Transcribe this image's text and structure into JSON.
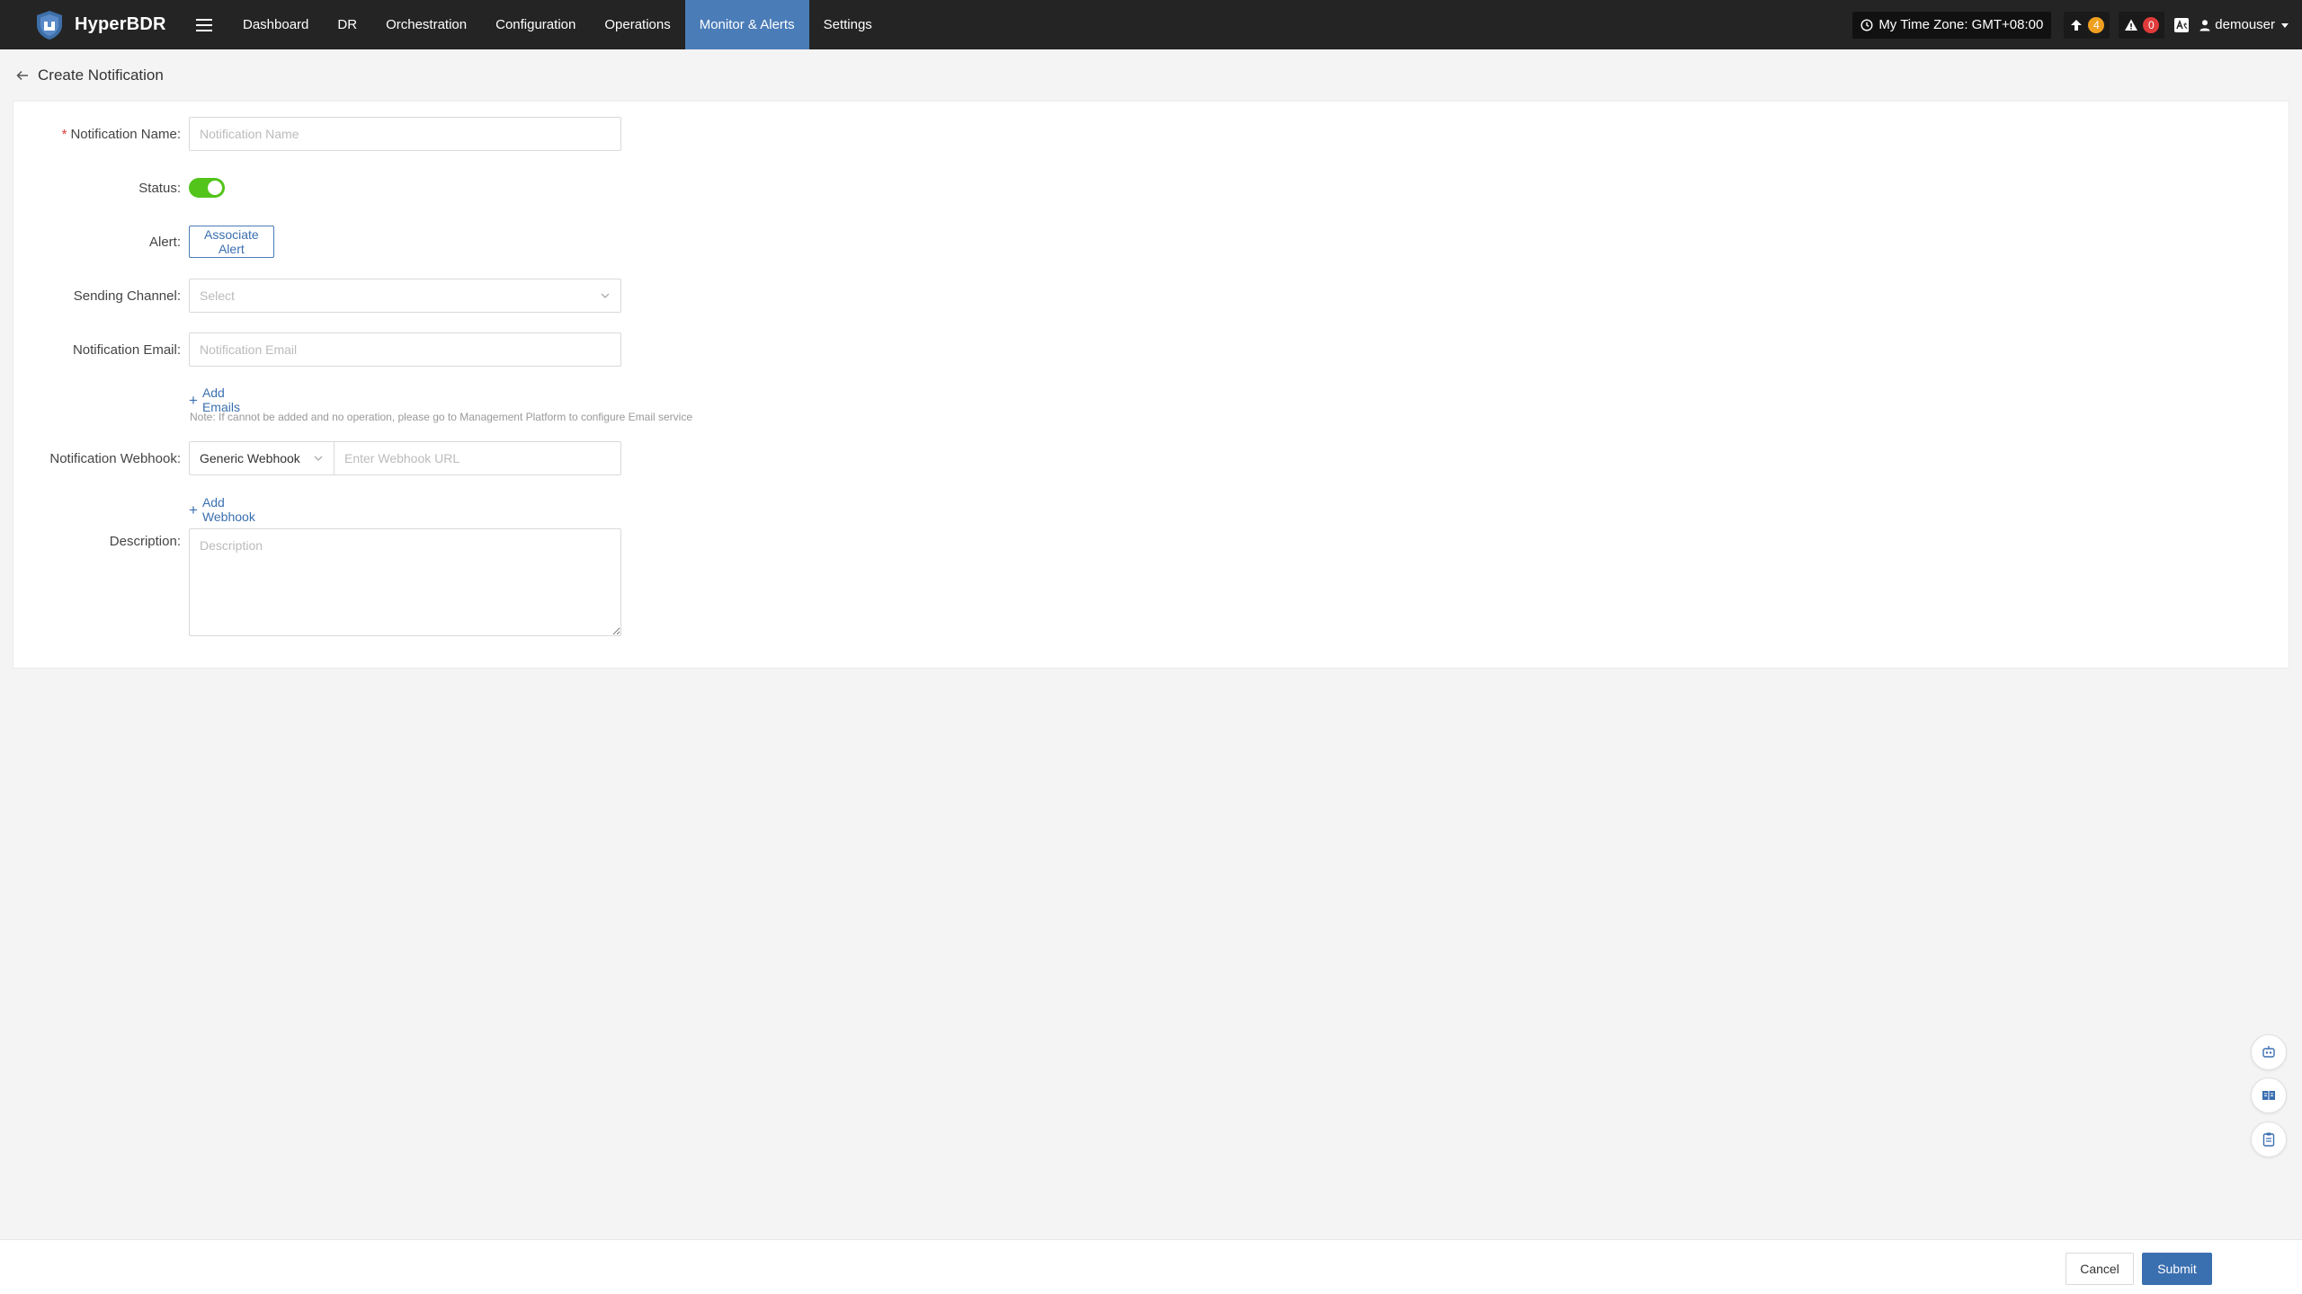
{
  "app": {
    "name": "HyperBDR",
    "logo_icon": "shield-logo-icon"
  },
  "nav": {
    "menu_icon": "hamburger-icon",
    "items": [
      {
        "label": "Dashboard",
        "active": false
      },
      {
        "label": "DR",
        "active": false
      },
      {
        "label": "Orchestration",
        "active": false
      },
      {
        "label": "Configuration",
        "active": false
      },
      {
        "label": "Operations",
        "active": false
      },
      {
        "label": "Monitor & Alerts",
        "active": true
      },
      {
        "label": "Settings",
        "active": false
      }
    ],
    "active_color": "#4a7cb8"
  },
  "header_right": {
    "timezone": "My Time Zone: GMT+08:00",
    "upgrade_count": "4",
    "alert_count": "0",
    "username": "demouser"
  },
  "page": {
    "title": "Create Notification"
  },
  "form": {
    "name": {
      "label": "Notification Name:",
      "required": "*",
      "placeholder": "Notification Name",
      "value": ""
    },
    "status": {
      "label": "Status:",
      "enabled": true
    },
    "alert": {
      "label": "Alert:",
      "button": "Associate Alert"
    },
    "channel": {
      "label": "Sending Channel:",
      "placeholder": "Select"
    },
    "email": {
      "label": "Notification Email:",
      "placeholder": "Notification Email",
      "value": ""
    },
    "add_emails": "Add Emails",
    "email_note": "Note: If cannot be added and no operation, please go to Management Platform to configure Email service",
    "webhook": {
      "label": "Notification Webhook:",
      "type": "Generic Webhook",
      "placeholder": "Enter Webhook URL"
    },
    "add_webhook": "Add Webhook",
    "description": {
      "label": "Description:",
      "placeholder": "Description"
    }
  },
  "footer": {
    "cancel": "Cancel",
    "submit": "Submit"
  },
  "colors": {
    "topbar": "#242424",
    "primary": "#3a6fb0",
    "toggle_on": "#52c41a",
    "badge_orange": "#f0a020",
    "badge_red": "#e03a3a"
  }
}
